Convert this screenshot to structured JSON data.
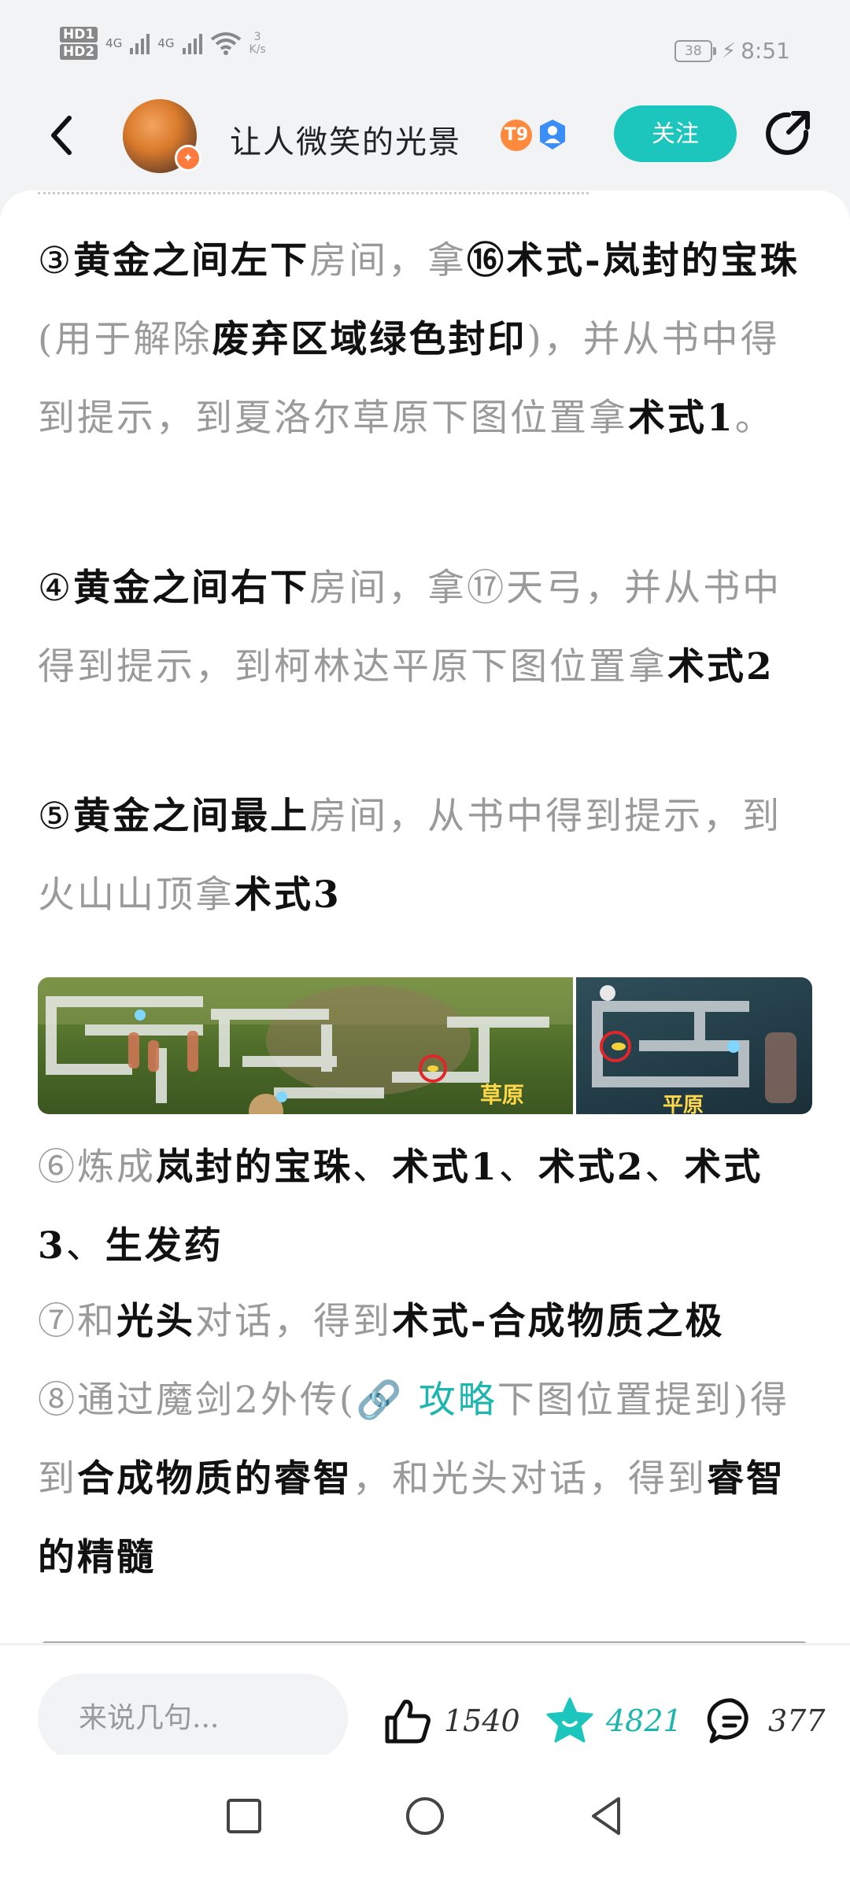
{
  "status_bar": {
    "hd1": "HD1",
    "hd2": "HD2",
    "net1": "4G",
    "net2": "4G",
    "speed_value": "3",
    "speed_unit": "K/s",
    "battery": "38",
    "time": "8:51"
  },
  "header": {
    "username": "让人微笑的光景",
    "level_badge": "T9",
    "follow_label": "关注"
  },
  "article": {
    "p3": [
      {
        "t": "③",
        "s": "d"
      },
      {
        "t": "黄金之间左下",
        "s": "b"
      },
      {
        "t": "房间，拿",
        "s": "g"
      },
      {
        "t": "⑯术式-岚封的宝珠",
        "s": "b"
      },
      {
        "t": "(用于解除",
        "s": "g"
      },
      {
        "t": "废弃区域绿色封印",
        "s": "b"
      },
      {
        "t": ")，并从书中得到提示，到夏洛尔草原下图位置拿",
        "s": "g"
      },
      {
        "t": "术式1",
        "s": "b"
      },
      {
        "t": "。",
        "s": "g"
      }
    ],
    "p4": [
      {
        "t": "④",
        "s": "d"
      },
      {
        "t": "黄金之间右下",
        "s": "b"
      },
      {
        "t": "房间，拿⑰天弓，并从书中得到提示，到柯林达平原下图位置拿",
        "s": "g"
      },
      {
        "t": "术式2",
        "s": "b"
      }
    ],
    "p5": [
      {
        "t": "⑤",
        "s": "d"
      },
      {
        "t": "黄金之间最上",
        "s": "b"
      },
      {
        "t": "房间，从书中得到提示，到火山山顶拿",
        "s": "g"
      },
      {
        "t": "术式3",
        "s": "b"
      }
    ],
    "p6": [
      {
        "t": "⑥炼成",
        "s": "g"
      },
      {
        "t": "岚封的宝珠",
        "s": "b"
      },
      {
        "t": "、",
        "s": "d"
      },
      {
        "t": "术式1",
        "s": "b"
      },
      {
        "t": "、",
        "s": "d"
      },
      {
        "t": "术式2",
        "s": "b"
      },
      {
        "t": "、",
        "s": "d"
      },
      {
        "t": "术式3",
        "s": "b"
      },
      {
        "t": "、",
        "s": "d"
      },
      {
        "t": "生发药",
        "s": "b"
      }
    ],
    "p7": [
      {
        "t": "⑦和",
        "s": "g"
      },
      {
        "t": "光头",
        "s": "b"
      },
      {
        "t": "对话，得到",
        "s": "g"
      },
      {
        "t": "术式-合成物质之极",
        "s": "b"
      }
    ],
    "p8": [
      {
        "t": "⑧通过魔剑2外传(",
        "s": "g"
      },
      {
        "t": "🔗 攻略",
        "s": "link"
      },
      {
        "t": "下图位置提到)得到",
        "s": "g"
      },
      {
        "t": "合成物质的睿智",
        "s": "b"
      },
      {
        "t": "，和光头对话，得到",
        "s": "g"
      },
      {
        "t": "睿智的精髓",
        "s": "b"
      }
    ],
    "map1_label": "草原",
    "map2_label": "平原"
  },
  "bottom_bar": {
    "comment_placeholder": "来说几句...",
    "likes": "1540",
    "favorites": "4821",
    "comments": "377"
  },
  "colors": {
    "accent": "#1cc6bd",
    "background": "#f1f3f5"
  }
}
